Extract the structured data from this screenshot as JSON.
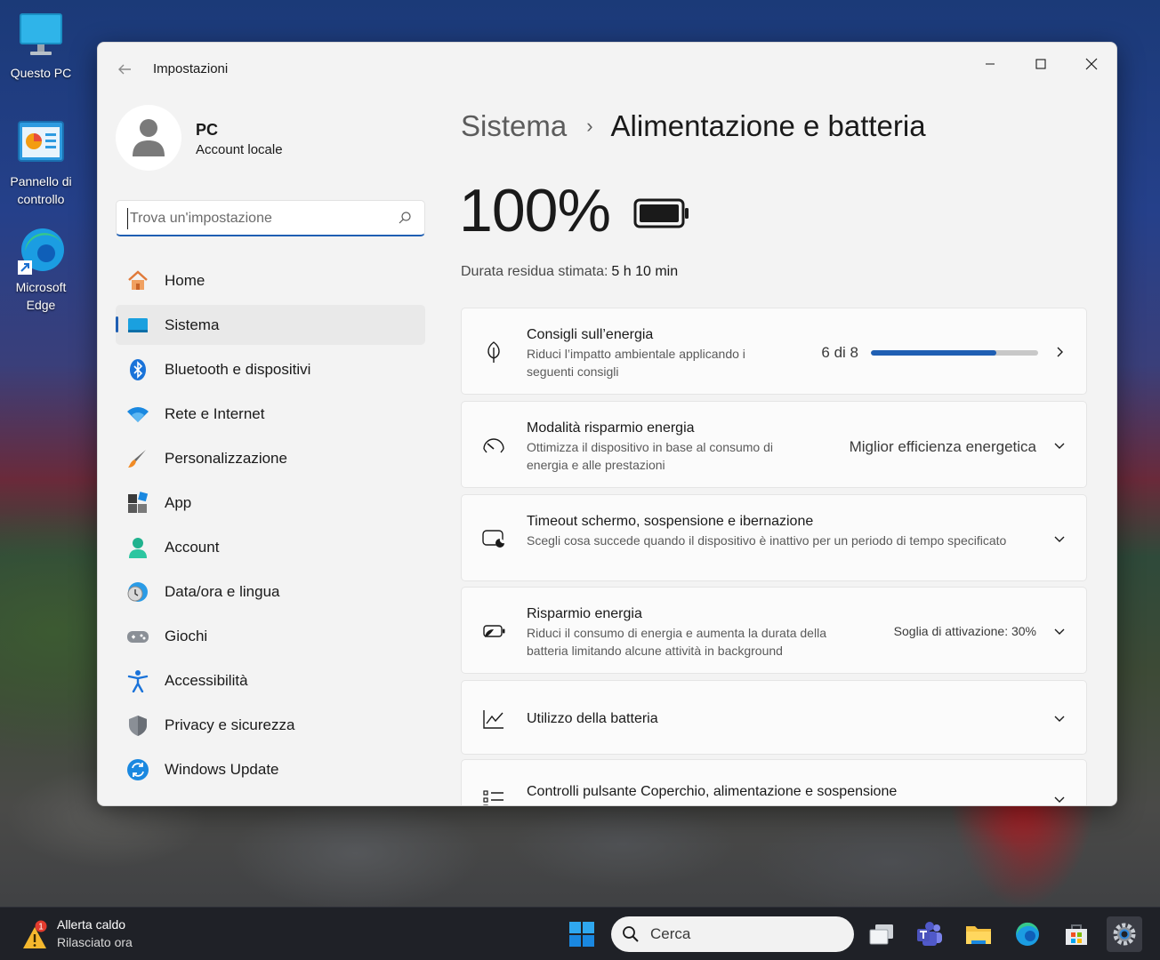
{
  "desktop": {
    "icons": [
      {
        "label": "Questo PC"
      },
      {
        "label": "Pannello di controllo"
      },
      {
        "label": "Microsoft Edge"
      }
    ]
  },
  "window": {
    "title": "Impostazioni",
    "controls": {
      "minimize": "minimize-icon",
      "maximize": "maximize-icon",
      "close": "close-icon"
    }
  },
  "profile": {
    "name": "PC",
    "subtitle": "Account locale"
  },
  "search": {
    "placeholder": "Trova un'impostazione"
  },
  "sidebar": {
    "items": [
      {
        "label": "Home",
        "icon": "home-icon"
      },
      {
        "label": "Sistema",
        "icon": "system-icon",
        "selected": true
      },
      {
        "label": "Bluetooth e dispositivi",
        "icon": "bluetooth-icon"
      },
      {
        "label": "Rete e Internet",
        "icon": "wifi-icon"
      },
      {
        "label": "Personalizzazione",
        "icon": "brush-icon"
      },
      {
        "label": "App",
        "icon": "apps-icon"
      },
      {
        "label": "Account",
        "icon": "account-icon"
      },
      {
        "label": "Data/ora e lingua",
        "icon": "clock-globe-icon"
      },
      {
        "label": "Giochi",
        "icon": "gamepad-icon"
      },
      {
        "label": "Accessibilità",
        "icon": "accessibility-icon"
      },
      {
        "label": "Privacy e sicurezza",
        "icon": "shield-icon"
      },
      {
        "label": "Windows Update",
        "icon": "update-icon"
      }
    ]
  },
  "main": {
    "breadcrumb": {
      "parent": "Sistema",
      "separator": "›",
      "current": "Alimentazione e batteria"
    },
    "battery": {
      "percent": "100%",
      "remaining_label": "Durata residua stimata:",
      "remaining_value": "5 h 10 min"
    },
    "cards": {
      "energy": {
        "title": "Consigli sull’energia",
        "desc": "Riduci l’impatto ambientale applicando i seguenti consigli",
        "value": "6 di 8",
        "progress": 0.75
      },
      "power_mode": {
        "title": "Modalità risparmio energia",
        "desc": "Ottimizza il dispositivo in base al consumo di energia e alle prestazioni",
        "value": "Miglior efficienza energetica"
      },
      "timeout": {
        "title": "Timeout schermo, sospensione e ibernazione",
        "desc": "Scegli cosa succede quando il dispositivo è inattivo per un periodo di tempo specificato"
      },
      "saver": {
        "title": "Risparmio energia",
        "desc": "Riduci il consumo di energia e aumenta la durata della batteria limitando alcune attività in background",
        "value": "Soglia di attivazione: 30%"
      },
      "usage": {
        "title": "Utilizzo della batteria"
      },
      "lid": {
        "title": "Controlli pulsante Coperchio, alimentazione e sospensione"
      }
    }
  },
  "taskbar": {
    "weather": {
      "title": "Allerta caldo",
      "subtitle": "Rilasciato ora",
      "badge": "1"
    },
    "search": {
      "label": "Cerca"
    },
    "colors": {
      "accent": "#1f5fb3",
      "taskbar": "#1f2127"
    }
  }
}
